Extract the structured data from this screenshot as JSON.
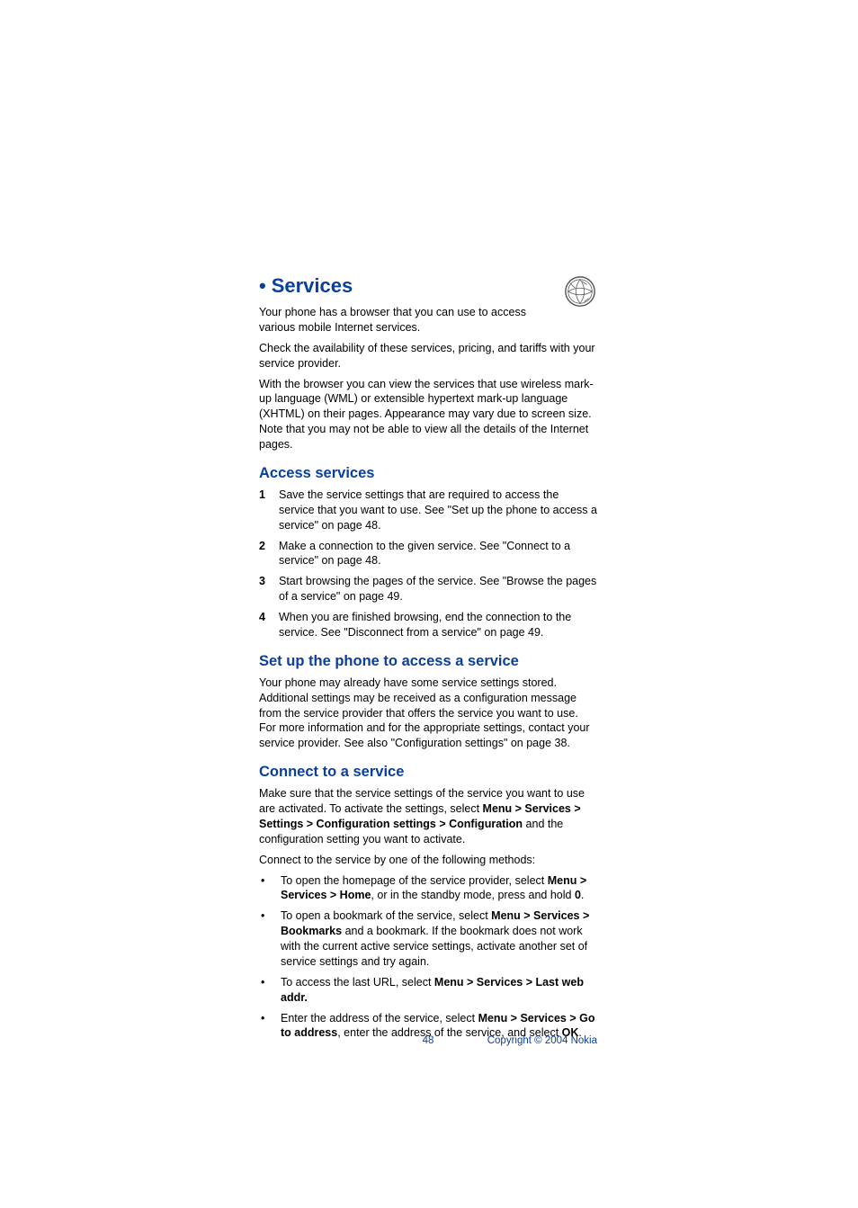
{
  "title": "Services",
  "intro_paragraphs": [
    "Your phone has a browser that you can use to access various mobile Internet services.",
    "Check the availability of these services, pricing, and tariffs with your service provider.",
    "With the browser you can view the services that use wireless mark-up language (WML) or extensible hypertext mark-up language (XHTML) on their pages. Appearance may vary due to screen size. Note that you may not be able to view all the details of the Internet pages."
  ],
  "section_access": {
    "heading": "Access services",
    "steps": [
      "Save the service settings that are required to access the service that you want to use. See \"Set up the phone to access a service\" on page 48.",
      "Make a connection to the given service. See \"Connect to a service\" on page 48.",
      "Start browsing the pages of the service. See \"Browse the pages of a service\" on page 49.",
      "When you are finished browsing, end the connection to the service. See \"Disconnect from a service\" on page 49."
    ]
  },
  "section_setup": {
    "heading": "Set up the phone to access a service",
    "body": "Your phone may already have some service settings stored. Additional settings may be received as a configuration message from the service provider that offers the service you want to use. For more information and for the appropriate settings, contact your service provider. See also \"Configuration settings\" on page 38."
  },
  "section_connect": {
    "heading": "Connect to a service",
    "p1_pre": "Make sure that the service settings of the service you want to use are activated. To activate the settings, select ",
    "p1_bold": "Menu > Services > Settings > Configuration settings > Configuration",
    "p1_post": " and the configuration setting you want to activate.",
    "p2": "Connect to the service by one of the following methods:",
    "items": [
      {
        "pre": "To open the homepage of the service provider, select ",
        "bold1": "Menu > Services > Home",
        "mid": ", or in the standby mode, press and hold ",
        "bold2": "0",
        "post": "."
      },
      {
        "pre": "To open a bookmark of the service, select ",
        "bold1": "Menu > Services > Bookmarks",
        "mid": " and a bookmark. If the bookmark does not work with the current active service settings, activate another set of service settings and try again.",
        "bold2": "",
        "post": ""
      },
      {
        "pre": "To access the last URL, select ",
        "bold1": "Menu > Services > Last web addr.",
        "mid": "",
        "bold2": "",
        "post": ""
      },
      {
        "pre": "Enter the address of the service, select ",
        "bold1": "Menu > Services > Go to address",
        "mid": ", enter the address of the service, and select ",
        "bold2": "OK",
        "post": "."
      }
    ]
  },
  "footer": {
    "page": "48",
    "copyright": "Copyright © 2004 Nokia"
  }
}
